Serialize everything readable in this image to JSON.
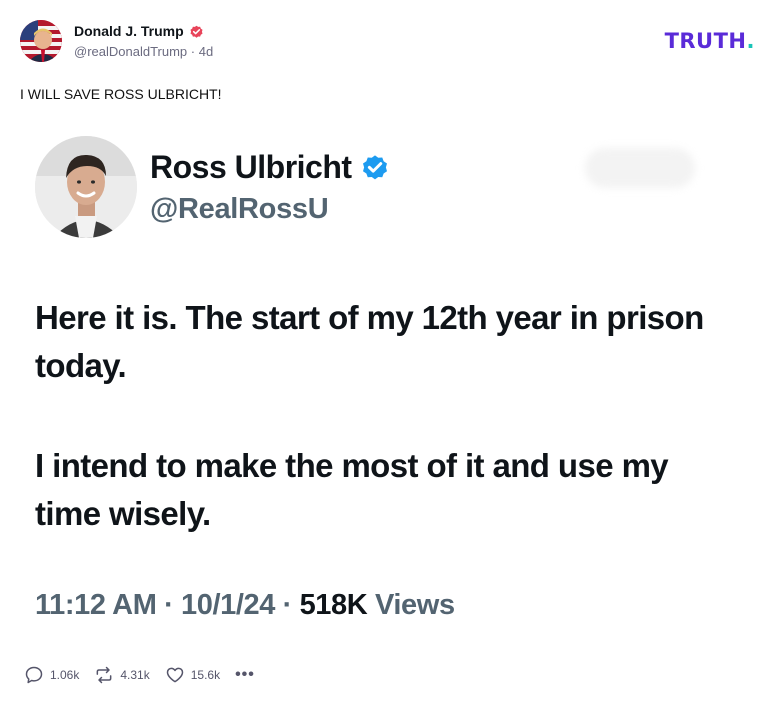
{
  "post": {
    "author_name": "Donald J. Trump",
    "author_handle": "@realDonaldTrump",
    "separator": "·",
    "age": "4d",
    "text": "I WILL SAVE ROSS ULBRICHT!"
  },
  "brand": {
    "logo_text": "TRUTH",
    "logo_dot": ".",
    "color_primary": "#5a2bd8",
    "color_accent": "#18c4b8"
  },
  "embedded_tweet": {
    "name": "Ross Ulbricht",
    "handle": "@RealRossU",
    "paragraphs": [
      "Here it is. The start of my 12th year in prison today.",
      "I intend to make the most of it and use my time wisely."
    ],
    "time": "11:12 AM",
    "date": "10/1/24",
    "meta_separator": " · ",
    "views_count": "518K",
    "views_label": "Views",
    "verified_color": "#1d9bf0"
  },
  "actions": {
    "replies": "1.06k",
    "retruths": "4.31k",
    "likes": "15.6k",
    "more_icon": "ellipsis-icon"
  }
}
